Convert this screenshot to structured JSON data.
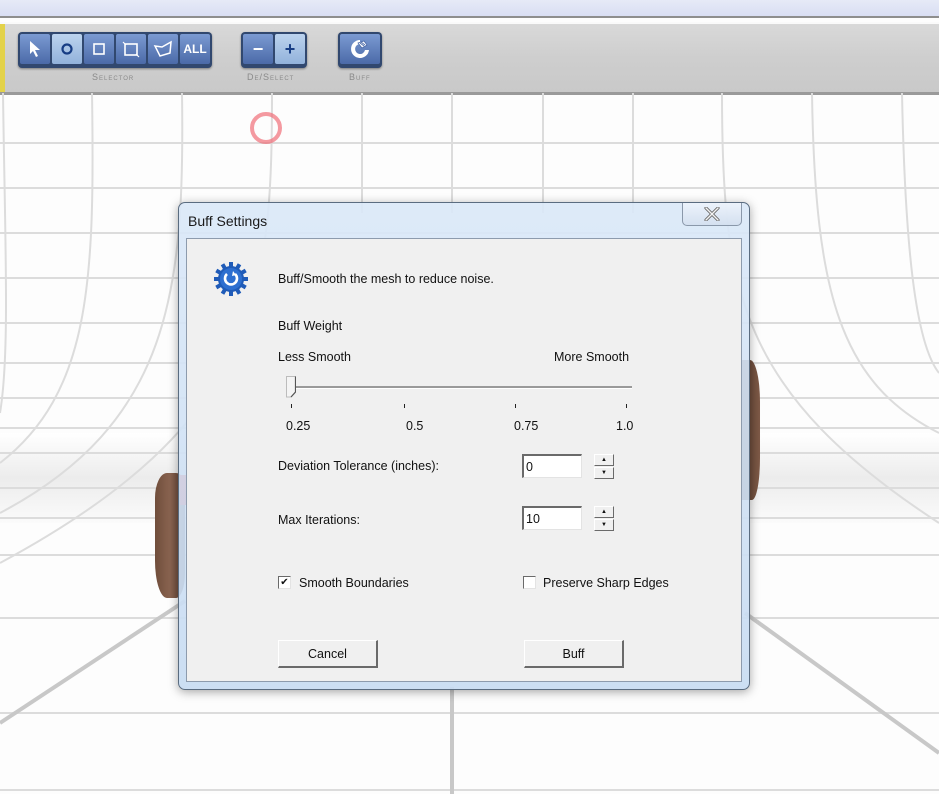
{
  "toolbar": {
    "selector": {
      "label": "Selector",
      "tools": [
        {
          "name": "pointer",
          "icon": "arrow-pointer-icon",
          "active": false
        },
        {
          "name": "circle",
          "icon": "circle-select-icon",
          "active": true
        },
        {
          "name": "square",
          "icon": "square-select-icon",
          "active": false
        },
        {
          "name": "rectangle",
          "icon": "rectangle-select-icon",
          "active": false
        },
        {
          "name": "lasso",
          "icon": "polygon-select-icon",
          "active": false
        },
        {
          "name": "all",
          "icon": "select-all",
          "label": "ALL",
          "active": false
        }
      ]
    },
    "deselect": {
      "label": "De/Select",
      "minus": "−",
      "plus": "+"
    },
    "buff": {
      "label": "Buff"
    }
  },
  "dialog": {
    "title": "Buff Settings",
    "description": "Buff/Smooth the mesh to reduce noise.",
    "buff_weight": {
      "label": "Buff Weight",
      "min_label": "Less Smooth",
      "max_label": "More Smooth",
      "value": 0.25,
      "min": 0.25,
      "max": 1.0,
      "ticks": [
        "0.25",
        "0.5",
        "0.75",
        "1.0"
      ]
    },
    "deviation_tolerance": {
      "label": "Deviation Tolerance (inches):",
      "value": "0"
    },
    "max_iterations": {
      "label": "Max Iterations:",
      "value": "10"
    },
    "smooth_boundaries": {
      "label": "Smooth Boundaries",
      "checked": true
    },
    "preserve_sharp_edges": {
      "label": "Preserve Sharp Edges",
      "checked": false
    },
    "cancel_label": "Cancel",
    "buff_label": "Buff"
  },
  "colors": {
    "toolbar_button": "#5a7ab8",
    "toolbar_button_active": "#a8c4e6",
    "dialog_client": "#f0f0f0",
    "cursor_ring": "#f0646e",
    "mesh": "#7a5442"
  }
}
